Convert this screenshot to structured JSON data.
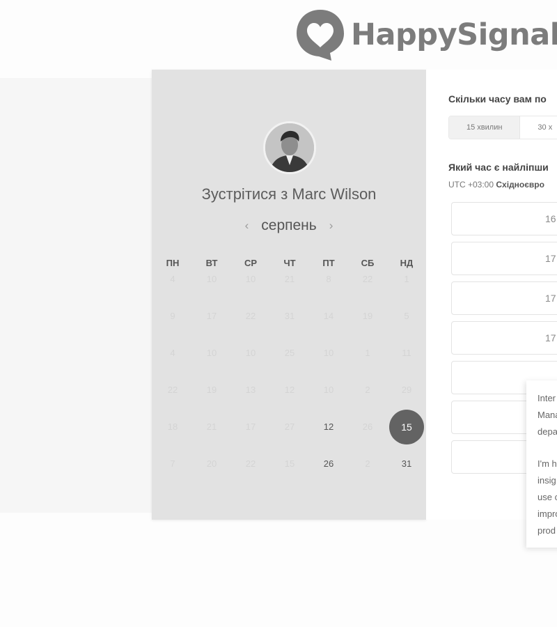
{
  "brand": {
    "name": "HappySignals",
    "icon": "heart-speech-bubble-icon"
  },
  "scheduler": {
    "title": "Зустрітися з Marc Wilson",
    "month": "серпень",
    "prev_icon": "chevron-left-icon",
    "next_icon": "chevron-right-icon",
    "weekdays": [
      "ПН",
      "ВТ",
      "СР",
      "ЧТ",
      "ПТ",
      "СБ",
      "НД"
    ],
    "weeks": [
      [
        "4",
        "10",
        "10",
        "21",
        "8",
        "22",
        "1"
      ],
      [
        "9",
        "17",
        "22",
        "31",
        "14",
        "19",
        "5"
      ],
      [
        "4",
        "10",
        "10",
        "25",
        "10",
        "1",
        "11"
      ],
      [
        "22",
        "19",
        "13",
        "12",
        "10",
        "2",
        "29"
      ],
      [
        "18",
        "21",
        "17",
        "27",
        "12",
        "26",
        "15"
      ],
      [
        "7",
        "20",
        "22",
        "15",
        "26",
        "2",
        "31"
      ]
    ],
    "available_days": [
      "12",
      "26",
      "31"
    ],
    "selected_day": "15"
  },
  "booking": {
    "duration_question": "Скільки часу вам по",
    "durations": [
      "15 хвилин",
      "30 х"
    ],
    "time_question": "Який час є найліпши",
    "timezone_offset": "UTC +03:00",
    "timezone_name": "Східноєвро",
    "slots": [
      "16",
      "17",
      "17",
      "17",
      "",
      "",
      ""
    ]
  },
  "bio_popup": {
    "lines_para1": [
      "Inter",
      "Mana",
      "depa"
    ],
    "lines_para2": [
      "I'm h",
      "insig",
      "use c",
      "impro",
      "prod"
    ]
  },
  "colors": {
    "selected_day_bg": "#636363",
    "left_panel_bg": "#e2e2e2",
    "logo_gray": "#7c7c7c"
  }
}
